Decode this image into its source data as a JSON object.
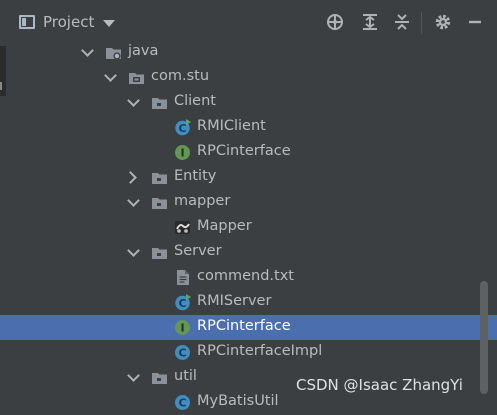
{
  "panel": {
    "title": "Project"
  },
  "tree": [
    {
      "label": "java",
      "icon": "java-source-folder-icon",
      "indent": 0,
      "arrow": "down"
    },
    {
      "label": "com.stu",
      "icon": "package-icon",
      "indent": 1,
      "arrow": "down"
    },
    {
      "label": "Client",
      "icon": "folder-icon",
      "indent": 2,
      "arrow": "down"
    },
    {
      "label": "RMIClient",
      "icon": "class-run-icon",
      "indent": 3,
      "arrow": ""
    },
    {
      "label": "RPCinterface",
      "icon": "interface-icon",
      "indent": 3,
      "arrow": ""
    },
    {
      "label": "Entity",
      "icon": "folder-icon",
      "indent": 2,
      "arrow": "right"
    },
    {
      "label": "mapper",
      "icon": "folder-icon",
      "indent": 2,
      "arrow": "down"
    },
    {
      "label": "Mapper",
      "icon": "mybatis-mapper-icon",
      "indent": 3,
      "arrow": ""
    },
    {
      "label": "Server",
      "icon": "folder-icon",
      "indent": 2,
      "arrow": "down"
    },
    {
      "label": "commend.txt",
      "icon": "text-file-icon",
      "indent": 3,
      "arrow": ""
    },
    {
      "label": "RMIServer",
      "icon": "class-run-icon",
      "indent": 3,
      "arrow": ""
    },
    {
      "label": "RPCinterface",
      "icon": "interface-icon",
      "indent": 3,
      "arrow": "",
      "selected": true
    },
    {
      "label": "RPCinterfaceImpl",
      "icon": "class-icon",
      "indent": 3,
      "arrow": ""
    },
    {
      "label": "util",
      "icon": "folder-icon",
      "indent": 2,
      "arrow": "down"
    },
    {
      "label": "MyBatisUtil",
      "icon": "class-icon",
      "indent": 3,
      "arrow": ""
    }
  ],
  "watermark": "CSDN @Isaac ZhangYi",
  "colors": {
    "background": "#3c3f41",
    "selection": "#4b6eaf",
    "class": "#3f8fc4",
    "interface": "#629755"
  }
}
